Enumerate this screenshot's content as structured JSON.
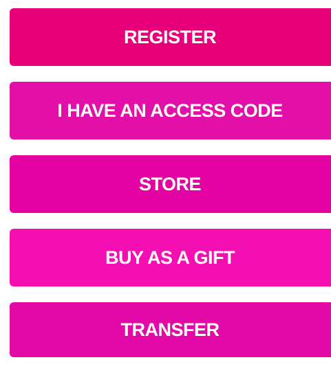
{
  "menu": {
    "buttons": [
      {
        "label": "REGISTER",
        "color": "#e8007a"
      },
      {
        "label": "I HAVE AN ACCESS CODE",
        "color": "#e20fa8"
      },
      {
        "label": "STORE",
        "color": "#e402a2"
      },
      {
        "label": "BUY AS A GIFT",
        "color": "#f30fb2"
      },
      {
        "label": "TRANSFER",
        "color": "#e209a6"
      }
    ]
  }
}
